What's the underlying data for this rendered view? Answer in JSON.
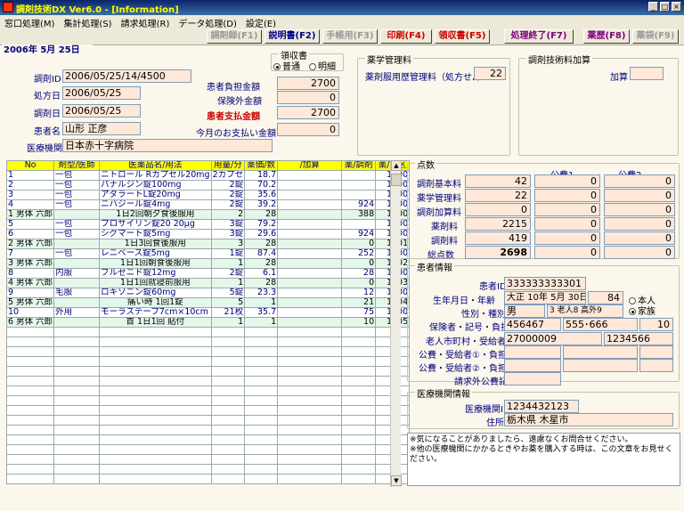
{
  "window": {
    "title": "調剤技術DX Ver6.0 - [Information]"
  },
  "menu": [
    "窓口処理(M)",
    "集計処理(S)",
    "請求処理(R)",
    "データ処理(D)",
    "設定(E)"
  ],
  "toolbar": {
    "buttons": [
      {
        "label": "調剤録(F1)",
        "color": "#9a9a9a"
      },
      {
        "label": "説明書(F2)",
        "color": "#00008b"
      },
      {
        "label": "手帳用(F3)",
        "color": "#9a9a9a"
      },
      {
        "label": "印刷(F4)",
        "color": "#cc0000"
      },
      {
        "label": "領収書(F5)",
        "color": "#cc0000"
      },
      {
        "label": "処理終了(F7)",
        "color": "#800080"
      },
      {
        "label": "薬歴(F8)",
        "color": "#800080"
      },
      {
        "label": "薬袋(F9)",
        "color": "#9a9a9a"
      }
    ]
  },
  "header": {
    "date": "2006年 5月 25日",
    "dispense_id_label": "調剤ID",
    "dispense_id": "2006/05/25/14/4500",
    "rx_date_label": "処方日",
    "rx_date": "2006/05/25",
    "dispense_date_label": "調剤日",
    "dispense_date": "2006/05/25",
    "patient_label": "患者名",
    "patient_name": "山形 正彦",
    "institution_label": "医療機関",
    "institution": "日本赤十字病院"
  },
  "receipt": {
    "title": "領収書",
    "opt1": "普通",
    "opt2": "明細",
    "burden_label": "患者負担金額",
    "burden": "2700",
    "noninsured_label": "保険外金額",
    "noninsured": "0",
    "pay_label": "患者支払金額",
    "pay": "2700",
    "month_label": "今月のお支払い金額",
    "month": "0"
  },
  "pharma_mgmt": {
    "title": "薬学管理料",
    "history_label": "薬剤服用歴管理料（処方せん",
    "history_value": "22"
  },
  "tech_add": {
    "title": "調剤技術料加算",
    "add_label": "加算",
    "add_value": ""
  },
  "rx_table": {
    "headers": [
      "No",
      "剤型/医師",
      "医薬品名/用法",
      "用量/分",
      "薬価/数",
      "/加算",
      "薬/調剤",
      "薬/調区"
    ],
    "rows": [
      {
        "c": [
          "1",
          "一包",
          "ニトロール Rカプセル20mg",
          "2カプセ",
          "18.7",
          "",
          "",
          "1000"
        ],
        "t": "b"
      },
      {
        "c": [
          "2",
          "一包",
          "パナルジン錠100mg",
          "2錠",
          "70.2",
          "",
          "",
          "1000"
        ],
        "t": "b"
      },
      {
        "c": [
          "3",
          "一包",
          "アダラートL錠20mg",
          "2錠",
          "35.6",
          "",
          "",
          "1000"
        ],
        "t": "b"
      },
      {
        "c": [
          "4",
          "一包",
          "ニバジール錠4mg",
          "2錠",
          "39.2",
          "",
          "924",
          "1000"
        ],
        "t": "b"
      },
      {
        "c": [
          "1  男体 六郎",
          "",
          "1日2回朝夕食後服用",
          "2",
          "28",
          "",
          "388",
          "1500"
        ],
        "t": "g"
      },
      {
        "c": [
          "5",
          "一包",
          "プロサイリン錠20 20μg",
          "3錠",
          "79.2",
          "",
          "",
          "1000"
        ],
        "t": "b"
      },
      {
        "c": [
          "6",
          "一包",
          "シグマート錠5mg",
          "3錠",
          "29.6",
          "",
          "924",
          "1000"
        ],
        "t": "b"
      },
      {
        "c": [
          "2  男体 六郎",
          "",
          "1日3回食後服用",
          "3",
          "28",
          "",
          "0",
          "1501"
        ],
        "t": "g"
      },
      {
        "c": [
          "7",
          "一包",
          "レニベース錠5mg",
          "1錠",
          "87.4",
          "",
          "252",
          "1000"
        ],
        "t": "b"
      },
      {
        "c": [
          "3  男体 六郎",
          "",
          "1日1回朝食後服用",
          "1",
          "28",
          "",
          "0",
          "1502"
        ],
        "t": "g"
      },
      {
        "c": [
          "8",
          "内服",
          "ブルゼニド錠12mg",
          "2錠",
          "6.1",
          "",
          "28",
          "1000"
        ],
        "t": "b"
      },
      {
        "c": [
          "4  男体 六郎",
          "",
          "1日1回就寝前服用",
          "1",
          "28",
          "",
          "0",
          "1203"
        ],
        "t": "g"
      },
      {
        "c": [
          "9",
          "毛服",
          "ロキソニン錠60mg",
          "5錠",
          "23.3",
          "",
          "12",
          "1000"
        ],
        "t": "b"
      },
      {
        "c": [
          "5  男体 六郎",
          "",
          "痛い時 1回1錠",
          "5",
          "1",
          "",
          "21",
          "1104"
        ],
        "t": "g"
      },
      {
        "c": [
          "10",
          "外用",
          "モーラステープ7cm×10cm",
          "21枚",
          "35.7",
          "",
          "75",
          "1000"
        ],
        "t": "b"
      },
      {
        "c": [
          "6  男体 六郎",
          "",
          "首 1日1回 貼付",
          "1",
          "1",
          "",
          "10",
          "1105"
        ],
        "t": "g"
      }
    ]
  },
  "points": {
    "title": "点数",
    "col1": "公費1",
    "col2": "公費2",
    "rows": [
      {
        "label": "調剤基本料",
        "v": "42",
        "p1": "0",
        "p2": "0"
      },
      {
        "label": "薬学管理料",
        "v": "22",
        "p1": "0",
        "p2": "0"
      },
      {
        "label": "調剤加算料",
        "v": "0",
        "p1": "0",
        "p2": "0"
      },
      {
        "label": "薬剤料",
        "v": "2215",
        "p1": "0",
        "p2": "0"
      },
      {
        "label": "調剤料",
        "v": "419",
        "p1": "0",
        "p2": "0"
      },
      {
        "label": "総点数",
        "v": "2698",
        "p1": "0",
        "p2": "0"
      }
    ]
  },
  "patient_info": {
    "title": "患者情報",
    "id_label": "患者ID",
    "id": "333333333301",
    "dob_label": "生年月日・年齢",
    "dob": "大正 10年 5月 30日",
    "age": "84",
    "opt_self": "本人",
    "opt_family": "家族",
    "sex_label": "性別・種別",
    "sex": "男",
    "kind": "3 老人8 高外9",
    "insurer_label": "保険者・記号・負担",
    "insurer": "456467",
    "symbol": "555･666",
    "burden": "10",
    "elder_label": "老人市町村・受給者",
    "elder_town": "27000009",
    "elder_rec": "1234566",
    "pub1_label": "公費・受給者①・負担",
    "pub2_label": "公費・受給者②・負担",
    "extra_label": "請求外公費記号"
  },
  "institution_info": {
    "title": "医療機関情報",
    "id_label": "医療機関ID",
    "id": "1234432123",
    "addr_label": "住所",
    "addr": "栃木県 木星市"
  },
  "notice": "※気になることがありましたら、遠慮なくお問合せください。\n※他の医療機関にかかるときやお薬を購入する時は、この文章をお見せください。"
}
